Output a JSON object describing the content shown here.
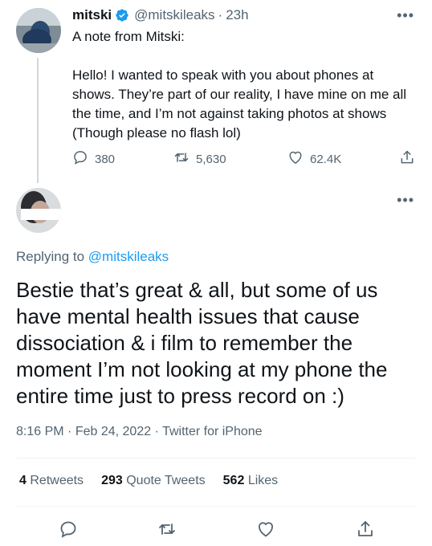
{
  "tweet1": {
    "display_name": "mitski",
    "verified_badge_icon": "verified-check-icon",
    "handle": "@mitskileaks",
    "separator": "·",
    "time": "23h",
    "more_icon": "more-dots-icon",
    "text": "A note from Mitski:\n\nHello! I wanted to speak with you about phones at shows. They’re part of our reality, I have mine on me all the time, and I’m not against taking photos at shows (Though please no flash lol)",
    "actions": {
      "reply_count": "380",
      "retweet_count": "5,630",
      "like_count": "62.4K"
    }
  },
  "tweet2": {
    "more_icon": "more-dots-icon",
    "replying_prefix": "Replying to",
    "replying_handle": "@mitskileaks",
    "text": "Bestie that’s great & all, but some of us have mental health issues that cause dissociation & i film to remember the moment I’m not looking at my phone the entire time just to press record on :)",
    "meta": {
      "time": "8:16 PM",
      "sep1": "·",
      "date": "Feb 24, 2022",
      "sep2": "·",
      "source": "Twitter for iPhone"
    },
    "stats": {
      "retweets_num": "4",
      "retweets_label": "Retweets",
      "quotes_num": "293",
      "quotes_label": "Quote Tweets",
      "likes_num": "562",
      "likes_label": "Likes"
    }
  },
  "colors": {
    "accent": "#1d9bf0",
    "secondary_text": "#536471",
    "primary_text": "#0f1419",
    "divider": "#eff3f4"
  }
}
